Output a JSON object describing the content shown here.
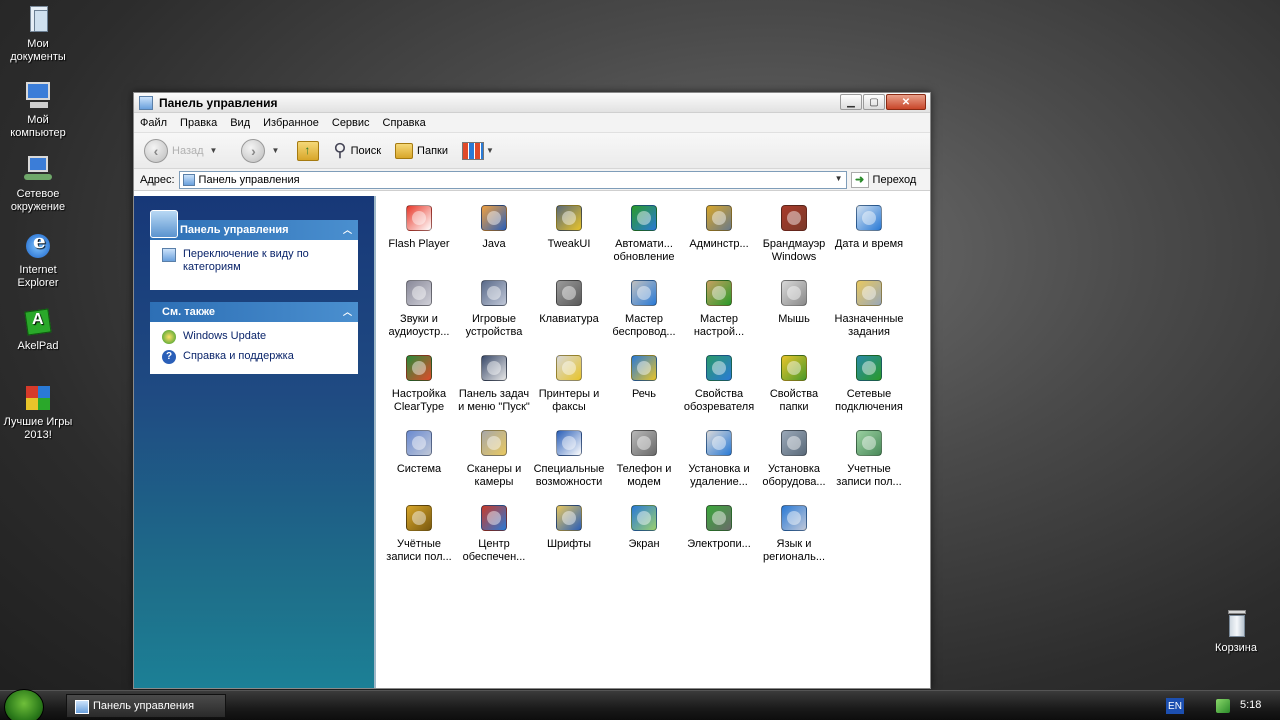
{
  "desktop": {
    "icons": [
      {
        "label": "Мои документы",
        "icon": "my-documents-icon"
      },
      {
        "label": "Мой компьютер",
        "icon": "my-computer-icon"
      },
      {
        "label": "Сетевое окружение",
        "icon": "network-places-icon"
      },
      {
        "label": "Internet Explorer",
        "icon": "internet-explorer-icon"
      },
      {
        "label": "AkelPad",
        "icon": "akelpad-icon"
      },
      {
        "label": "Лучшие Игры 2013!",
        "icon": "games-icon"
      },
      {
        "label": "Корзина",
        "icon": "recycle-bin-icon"
      }
    ]
  },
  "window": {
    "title": "Панель управления",
    "menu": [
      "Файл",
      "Правка",
      "Вид",
      "Избранное",
      "Сервис",
      "Справка"
    ],
    "toolbar": {
      "back": "Назад",
      "search": "Поиск",
      "folders": "Папки"
    },
    "address": {
      "label": "Адрес:",
      "value": "Панель управления",
      "go": "Переход"
    },
    "left_panel": {
      "control_panel": {
        "title": "Панель управления",
        "task": "Переключение к виду по категориям"
      },
      "see_also": {
        "title": "См. также",
        "items": [
          "Windows Update",
          "Справка и поддержка"
        ]
      }
    },
    "items": [
      {
        "label": "Flash Player",
        "icon": "flash-player-icon"
      },
      {
        "label": "Java",
        "icon": "java-icon"
      },
      {
        "label": "TweakUI",
        "icon": "tweakui-icon"
      },
      {
        "label": "Автомати... обновление",
        "icon": "automatic-updates-icon"
      },
      {
        "label": "Админстр...",
        "icon": "administrative-tools-icon"
      },
      {
        "label": "Брандмауэр Windows",
        "icon": "firewall-icon"
      },
      {
        "label": "Дата и время",
        "icon": "date-time-icon"
      },
      {
        "label": "Звуки и аудиоустр...",
        "icon": "sounds-icon"
      },
      {
        "label": "Игровые устройства",
        "icon": "game-controllers-icon"
      },
      {
        "label": "Клавиатура",
        "icon": "keyboard-icon"
      },
      {
        "label": "Мастер беспровод...",
        "icon": "wireless-wizard-icon"
      },
      {
        "label": "Мастер настрой...",
        "icon": "network-setup-wizard-icon"
      },
      {
        "label": "Мышь",
        "icon": "mouse-icon"
      },
      {
        "label": "Назначенные задания",
        "icon": "scheduled-tasks-icon"
      },
      {
        "label": "Настройка ClearType",
        "icon": "cleartype-icon"
      },
      {
        "label": "Панель задач и меню \"Пуск\"",
        "icon": "taskbar-start-menu-icon"
      },
      {
        "label": "Принтеры и факсы",
        "icon": "printers-faxes-icon"
      },
      {
        "label": "Речь",
        "icon": "speech-icon"
      },
      {
        "label": "Свойства обозревателя",
        "icon": "internet-options-icon"
      },
      {
        "label": "Свойства папки",
        "icon": "folder-options-icon"
      },
      {
        "label": "Сетевые подключения",
        "icon": "network-connections-icon"
      },
      {
        "label": "Система",
        "icon": "system-icon"
      },
      {
        "label": "Сканеры и камеры",
        "icon": "scanners-cameras-icon"
      },
      {
        "label": "Специальные возможности",
        "icon": "accessibility-icon"
      },
      {
        "label": "Телефон и модем",
        "icon": "phone-modem-icon"
      },
      {
        "label": "Установка и удаление...",
        "icon": "add-remove-programs-icon"
      },
      {
        "label": "Установка оборудова...",
        "icon": "add-hardware-icon"
      },
      {
        "label": "Учетные записи пол...",
        "icon": "user-accounts-icon"
      },
      {
        "label": "Учётные записи пол...",
        "icon": "user-accounts-2-icon"
      },
      {
        "label": "Центр обеспечен...",
        "icon": "security-center-icon"
      },
      {
        "label": "Шрифты",
        "icon": "fonts-icon"
      },
      {
        "label": "Экран",
        "icon": "display-icon"
      },
      {
        "label": "Электропи...",
        "icon": "power-options-icon"
      },
      {
        "label": "Язык и региональ...",
        "icon": "regional-options-icon"
      }
    ]
  },
  "taskbar": {
    "task_label": "Панель управления",
    "lang": "EN",
    "clock": "5:18"
  }
}
